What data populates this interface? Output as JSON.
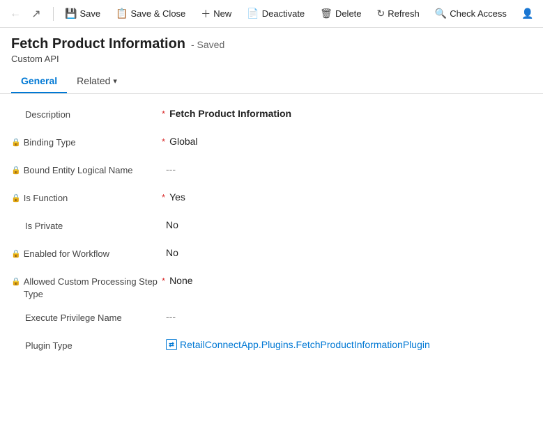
{
  "toolbar": {
    "back_label": "←",
    "forward_label": "↗",
    "save_label": "Save",
    "save_close_label": "Save & Close",
    "new_label": "New",
    "deactivate_label": "Deactivate",
    "delete_label": "Delete",
    "refresh_label": "Refresh",
    "check_access_label": "Check Access",
    "user_icon": "👤"
  },
  "header": {
    "title": "Fetch Product Information",
    "saved_status": "- Saved",
    "subtitle": "Custom API"
  },
  "tabs": {
    "general": "General",
    "related": "Related"
  },
  "form": {
    "fields": [
      {
        "label": "Description",
        "required": true,
        "locked": false,
        "value": "Fetch Product Information",
        "value_type": "bold",
        "muted": false
      },
      {
        "label": "Binding Type",
        "required": true,
        "locked": true,
        "value": "Global",
        "value_type": "normal",
        "muted": false
      },
      {
        "label": "Bound Entity Logical Name",
        "required": false,
        "locked": true,
        "value": "---",
        "value_type": "normal",
        "muted": true
      },
      {
        "label": "Is Function",
        "required": true,
        "locked": true,
        "value": "Yes",
        "value_type": "normal",
        "muted": false
      },
      {
        "label": "Is Private",
        "required": false,
        "locked": false,
        "value": "No",
        "value_type": "normal",
        "muted": false
      },
      {
        "label": "Enabled for Workflow",
        "required": false,
        "locked": true,
        "value": "No",
        "value_type": "normal",
        "muted": false
      },
      {
        "label": "Allowed Custom Processing Step Type",
        "required": true,
        "locked": true,
        "value": "None",
        "value_type": "normal",
        "muted": false
      },
      {
        "label": "Execute Privilege Name",
        "required": false,
        "locked": false,
        "value": "---",
        "value_type": "normal",
        "muted": true
      },
      {
        "label": "Plugin Type",
        "required": false,
        "locked": false,
        "value": "RetailConnectApp.Plugins.FetchProductInformationPlugin",
        "value_type": "link",
        "muted": false
      }
    ]
  },
  "colors": {
    "active_tab": "#0078d4",
    "link": "#0078d4",
    "required": "#d92b2b",
    "muted": "#888"
  }
}
